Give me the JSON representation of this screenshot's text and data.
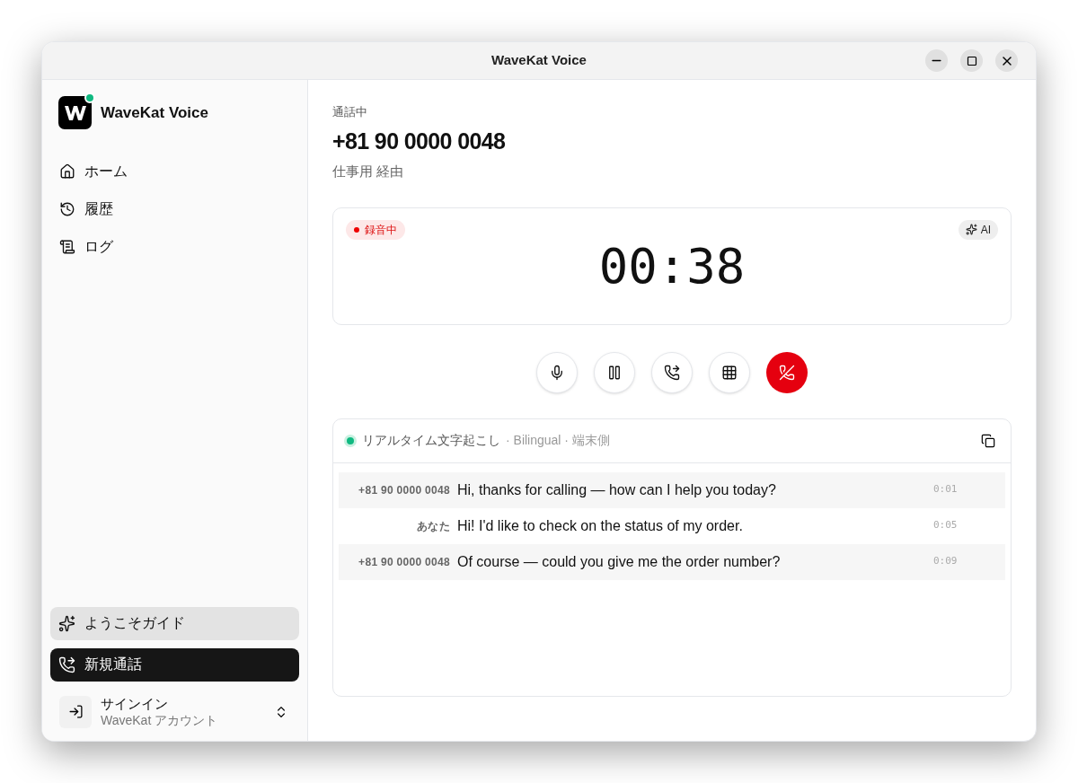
{
  "window": {
    "title": "WaveKat Voice"
  },
  "sidebar": {
    "app_name": "WaveKat Voice",
    "nav": [
      {
        "kind": "home",
        "label": "ホーム"
      },
      {
        "kind": "history",
        "label": "履歴"
      },
      {
        "kind": "log",
        "label": "ログ"
      }
    ],
    "guide_button": "ようこそガイド",
    "new_call_button": "新規通話",
    "account": {
      "title": "サインイン",
      "subtitle": "WaveKat アカウント"
    }
  },
  "call": {
    "status": "通話中",
    "number": "+81 90 0000 0048",
    "via": "仕事用 経由"
  },
  "timer": {
    "recording": true,
    "recording_label": "録音中",
    "ai_label": "AI",
    "time": "00:38"
  },
  "controls": [
    {
      "kind": "mute"
    },
    {
      "kind": "hold"
    },
    {
      "kind": "transfer"
    },
    {
      "kind": "keypad"
    },
    {
      "kind": "hangup"
    }
  ],
  "transcript": {
    "live": true,
    "title": "リアルタイム文字起こし",
    "meta": "· Bilingual · 端末側",
    "rows": [
      {
        "kind": "remote",
        "speaker": "+81 90 0000 0048",
        "text": "Hi, thanks for calling — how can I help you today?",
        "time": "0:01"
      },
      {
        "kind": "self",
        "speaker": "あなた",
        "text": "Hi! I'd like to check on the status of my order.",
        "time": "0:05"
      },
      {
        "kind": "remote",
        "speaker": "+81 90 0000 0048",
        "text": "Of course — could you give me the order number?",
        "time": "0:09"
      }
    ]
  }
}
